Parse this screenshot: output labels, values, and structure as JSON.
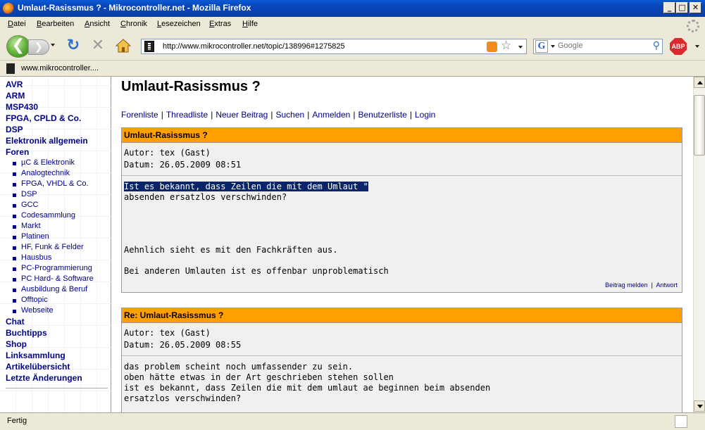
{
  "window": {
    "title": "Umlaut-Rasissmus ? - Mikrocontroller.net - Mozilla Firefox",
    "min_glyph": "_",
    "max_glyph": "□",
    "close_glyph": "✕"
  },
  "menu": [
    "Datei",
    "Bearbeiten",
    "Ansicht",
    "Chronik",
    "Lesezeichen",
    "Extras",
    "Hilfe"
  ],
  "toolbar": {
    "back_glyph": "❮",
    "forward_glyph": "❯",
    "reload_glyph": "↻",
    "stop_glyph": "✕",
    "url": "http://www.mikrocontroller.net/topic/138996#1275825",
    "search_placeholder": "Google",
    "search_engine_glyph": "G",
    "search_glyph": "⚲",
    "star_glyph": "☆",
    "abp_label": "ABP"
  },
  "tab": {
    "label": "www.mikrocontroller...."
  },
  "sidebar": {
    "top_items": [
      "AVR",
      "ARM",
      "MSP430",
      "FPGA, CPLD & Co.",
      "DSP",
      "Elektronik allgemein",
      "Foren"
    ],
    "forum_items": [
      "µC & Elektronik",
      "Analogtechnik",
      "FPGA, VHDL & Co.",
      "DSP",
      "GCC",
      "Codesammlung",
      "Markt",
      "Platinen",
      "HF, Funk & Felder",
      "Hausbus",
      "PC-Programmierung",
      "PC Hard- & Software",
      "Ausbildung & Beruf",
      "Offtopic",
      "Webseite"
    ],
    "bottom_items": [
      "Chat",
      "Buchtipps",
      "Shop",
      "Linksammlung",
      "Artikelübersicht",
      "Letzte Änderungen"
    ]
  },
  "page": {
    "title": "Umlaut-Rasissmus ?",
    "nav_links": [
      "Forenliste",
      "Threadliste",
      "Neuer Beitrag",
      "Suchen",
      "Anmelden",
      "Benutzerliste",
      "Login"
    ]
  },
  "posts": [
    {
      "subject": "Umlaut-Rasissmus ?",
      "author": "Autor: tex (Gast)",
      "date": "Datum: 26.05.2009 08:51",
      "highlight": "Ist es bekannt, dass Zeilen die mit dem Umlaut \"",
      "body": "absenden ersatzlos verschwinden?\n\n\n\n\nAehnlich sieht es mit den Fachkräften aus.\n\nBei anderen Umlauten ist es offenbar unproblematisch",
      "report_label": "Beitrag melden",
      "reply_label": "Antwort"
    },
    {
      "subject": "Re: Umlaut-Rasissmus ?",
      "author": "Autor: tex (Gast)",
      "date": "Datum: 26.05.2009 08:55",
      "body": "das problem scheint noch umfassender zu sein.\noben hätte etwas in der Art geschrieben stehen sollen\nist es bekannt, dass Zeilen die mit dem umlaut ae beginnen beim absenden\nersatzlos verschwinden?"
    }
  ],
  "status": {
    "text": "Fertig"
  }
}
